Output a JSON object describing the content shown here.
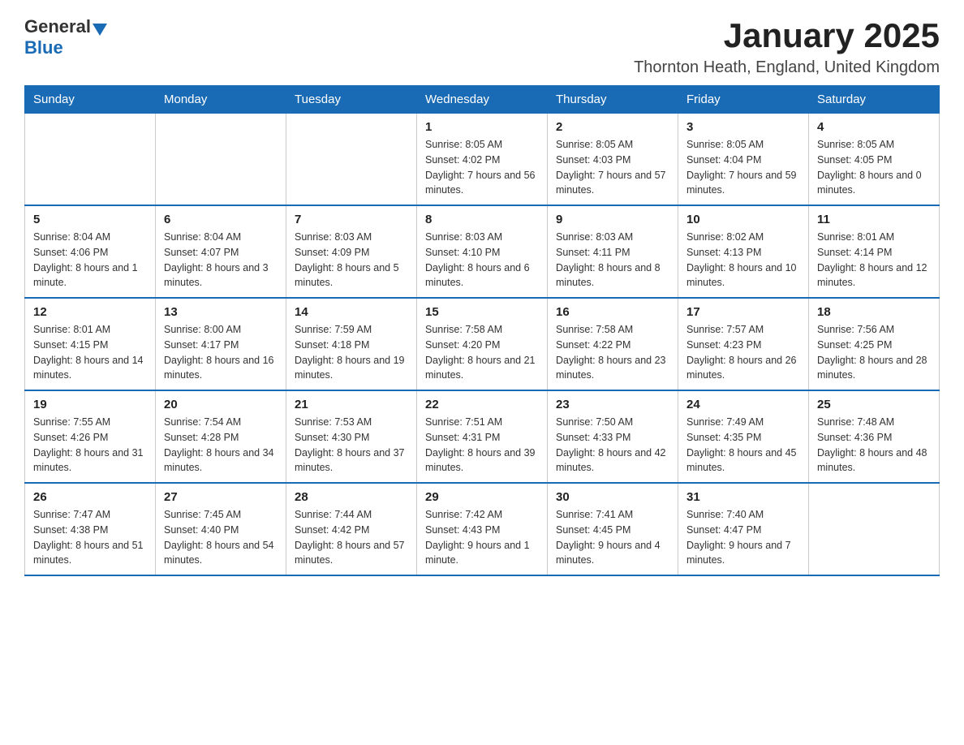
{
  "logo": {
    "general": "General",
    "blue": "Blue"
  },
  "title": "January 2025",
  "subtitle": "Thornton Heath, England, United Kingdom",
  "days_of_week": [
    "Sunday",
    "Monday",
    "Tuesday",
    "Wednesday",
    "Thursday",
    "Friday",
    "Saturday"
  ],
  "weeks": [
    [
      {
        "day": "",
        "info": ""
      },
      {
        "day": "",
        "info": ""
      },
      {
        "day": "",
        "info": ""
      },
      {
        "day": "1",
        "info": "Sunrise: 8:05 AM\nSunset: 4:02 PM\nDaylight: 7 hours and 56 minutes."
      },
      {
        "day": "2",
        "info": "Sunrise: 8:05 AM\nSunset: 4:03 PM\nDaylight: 7 hours and 57 minutes."
      },
      {
        "day": "3",
        "info": "Sunrise: 8:05 AM\nSunset: 4:04 PM\nDaylight: 7 hours and 59 minutes."
      },
      {
        "day": "4",
        "info": "Sunrise: 8:05 AM\nSunset: 4:05 PM\nDaylight: 8 hours and 0 minutes."
      }
    ],
    [
      {
        "day": "5",
        "info": "Sunrise: 8:04 AM\nSunset: 4:06 PM\nDaylight: 8 hours and 1 minute."
      },
      {
        "day": "6",
        "info": "Sunrise: 8:04 AM\nSunset: 4:07 PM\nDaylight: 8 hours and 3 minutes."
      },
      {
        "day": "7",
        "info": "Sunrise: 8:03 AM\nSunset: 4:09 PM\nDaylight: 8 hours and 5 minutes."
      },
      {
        "day": "8",
        "info": "Sunrise: 8:03 AM\nSunset: 4:10 PM\nDaylight: 8 hours and 6 minutes."
      },
      {
        "day": "9",
        "info": "Sunrise: 8:03 AM\nSunset: 4:11 PM\nDaylight: 8 hours and 8 minutes."
      },
      {
        "day": "10",
        "info": "Sunrise: 8:02 AM\nSunset: 4:13 PM\nDaylight: 8 hours and 10 minutes."
      },
      {
        "day": "11",
        "info": "Sunrise: 8:01 AM\nSunset: 4:14 PM\nDaylight: 8 hours and 12 minutes."
      }
    ],
    [
      {
        "day": "12",
        "info": "Sunrise: 8:01 AM\nSunset: 4:15 PM\nDaylight: 8 hours and 14 minutes."
      },
      {
        "day": "13",
        "info": "Sunrise: 8:00 AM\nSunset: 4:17 PM\nDaylight: 8 hours and 16 minutes."
      },
      {
        "day": "14",
        "info": "Sunrise: 7:59 AM\nSunset: 4:18 PM\nDaylight: 8 hours and 19 minutes."
      },
      {
        "day": "15",
        "info": "Sunrise: 7:58 AM\nSunset: 4:20 PM\nDaylight: 8 hours and 21 minutes."
      },
      {
        "day": "16",
        "info": "Sunrise: 7:58 AM\nSunset: 4:22 PM\nDaylight: 8 hours and 23 minutes."
      },
      {
        "day": "17",
        "info": "Sunrise: 7:57 AM\nSunset: 4:23 PM\nDaylight: 8 hours and 26 minutes."
      },
      {
        "day": "18",
        "info": "Sunrise: 7:56 AM\nSunset: 4:25 PM\nDaylight: 8 hours and 28 minutes."
      }
    ],
    [
      {
        "day": "19",
        "info": "Sunrise: 7:55 AM\nSunset: 4:26 PM\nDaylight: 8 hours and 31 minutes."
      },
      {
        "day": "20",
        "info": "Sunrise: 7:54 AM\nSunset: 4:28 PM\nDaylight: 8 hours and 34 minutes."
      },
      {
        "day": "21",
        "info": "Sunrise: 7:53 AM\nSunset: 4:30 PM\nDaylight: 8 hours and 37 minutes."
      },
      {
        "day": "22",
        "info": "Sunrise: 7:51 AM\nSunset: 4:31 PM\nDaylight: 8 hours and 39 minutes."
      },
      {
        "day": "23",
        "info": "Sunrise: 7:50 AM\nSunset: 4:33 PM\nDaylight: 8 hours and 42 minutes."
      },
      {
        "day": "24",
        "info": "Sunrise: 7:49 AM\nSunset: 4:35 PM\nDaylight: 8 hours and 45 minutes."
      },
      {
        "day": "25",
        "info": "Sunrise: 7:48 AM\nSunset: 4:36 PM\nDaylight: 8 hours and 48 minutes."
      }
    ],
    [
      {
        "day": "26",
        "info": "Sunrise: 7:47 AM\nSunset: 4:38 PM\nDaylight: 8 hours and 51 minutes."
      },
      {
        "day": "27",
        "info": "Sunrise: 7:45 AM\nSunset: 4:40 PM\nDaylight: 8 hours and 54 minutes."
      },
      {
        "day": "28",
        "info": "Sunrise: 7:44 AM\nSunset: 4:42 PM\nDaylight: 8 hours and 57 minutes."
      },
      {
        "day": "29",
        "info": "Sunrise: 7:42 AM\nSunset: 4:43 PM\nDaylight: 9 hours and 1 minute."
      },
      {
        "day": "30",
        "info": "Sunrise: 7:41 AM\nSunset: 4:45 PM\nDaylight: 9 hours and 4 minutes."
      },
      {
        "day": "31",
        "info": "Sunrise: 7:40 AM\nSunset: 4:47 PM\nDaylight: 9 hours and 7 minutes."
      },
      {
        "day": "",
        "info": ""
      }
    ]
  ]
}
